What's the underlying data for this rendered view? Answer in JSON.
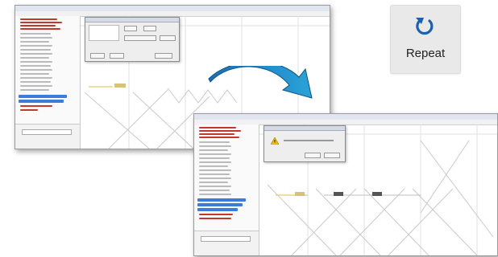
{
  "repeat": {
    "label": "Repeat",
    "icon": "repeat-icon",
    "icon_color": "#1f5fb0"
  },
  "arrow": {
    "icon": "curved-arrow-icon",
    "colors": [
      "#1a6fb8",
      "#2aa3d8"
    ]
  },
  "colors": {
    "selection": "#3b7dd8",
    "tree_red": "#c0392b",
    "window_border": "#9a9a9a"
  }
}
